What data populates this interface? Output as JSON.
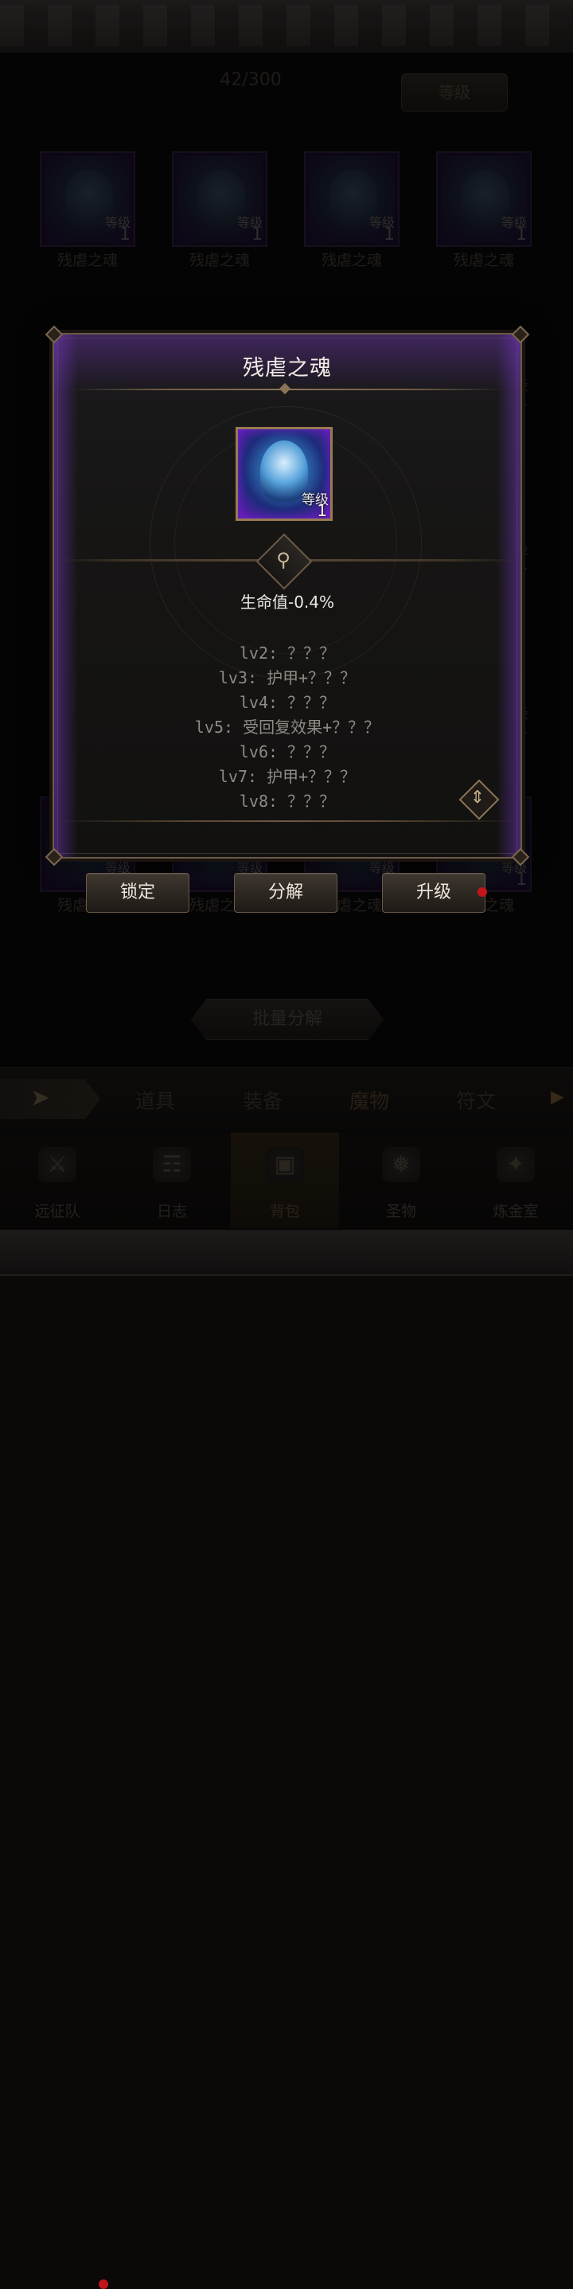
{
  "inventory": {
    "count_text": "42/300",
    "sort_label": "等级",
    "cards": [
      {
        "name": "残虐之魂",
        "level_label": "等级",
        "level": "1"
      },
      {
        "name": "残虐之魂",
        "level_label": "等级",
        "level": "1"
      },
      {
        "name": "残虐之魂",
        "level_label": "等级",
        "level": "1"
      },
      {
        "name": "残虐之魂",
        "level_label": "等级",
        "level": "1"
      }
    ],
    "bottom_cards": [
      {
        "name": "残虐之魂",
        "level_label": "等级",
        "level": "1"
      },
      {
        "name": "残虐之魂",
        "level_label": "等级",
        "level": "1"
      },
      {
        "name": "残虐之魂",
        "level_label": "等级",
        "level": "1"
      },
      {
        "name": "残虐之魂",
        "level_label": "等级",
        "level": "1"
      }
    ],
    "right_col_levels": [
      {
        "level_label": "级",
        "level": "1"
      },
      {
        "level_label": "级",
        "level": "1"
      },
      {
        "level_label": "级",
        "level": "1"
      }
    ],
    "batch_label": "批量分解"
  },
  "tabs": [
    {
      "label": "道具"
    },
    {
      "label": "装备"
    },
    {
      "label": "魔物",
      "active": true
    },
    {
      "label": "符文"
    }
  ],
  "nav": [
    {
      "label": "远征队",
      "icon": "helmet-icon"
    },
    {
      "label": "日志",
      "icon": "scroll-icon"
    },
    {
      "label": "背包",
      "icon": "backpack-icon",
      "active": true
    },
    {
      "label": "圣物",
      "icon": "flame-icon"
    },
    {
      "label": "炼金室",
      "icon": "alchemy-icon"
    }
  ],
  "popup": {
    "title": "残虐之魂",
    "icon_level_label": "等级",
    "icon_level": "1",
    "main_stat": "生命值-0.4%",
    "levels": [
      "lv2: ？？？",
      "lv3: 护甲+？？？",
      "lv4: ？？？",
      "lv5: 受回复效果+？？？",
      "lv6: ？？？",
      "lv7: 护甲+？？？",
      "lv8: ？？？"
    ]
  },
  "actions": {
    "lock": "锁定",
    "decompose": "分解",
    "upgrade": "升级"
  },
  "colors": {
    "accent_gold": "#9a7a52",
    "rare_purple": "#6a34aa",
    "notification_red": "#c0161a"
  }
}
